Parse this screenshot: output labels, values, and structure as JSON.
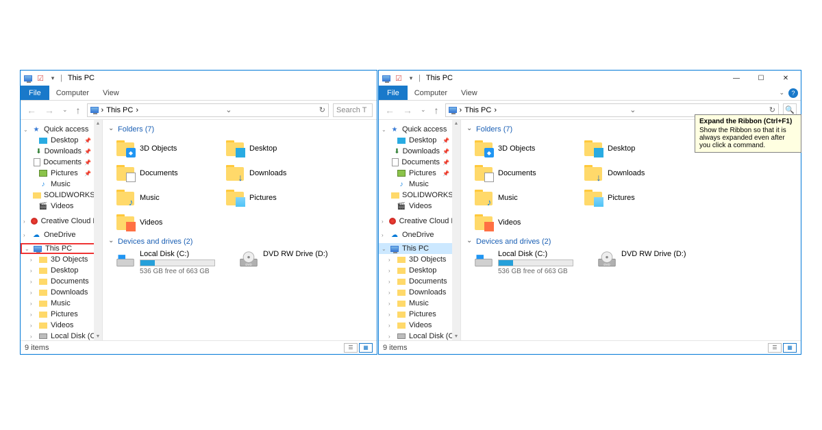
{
  "window_title": "This PC",
  "tabs": {
    "file": "File",
    "computer": "Computer",
    "view": "View"
  },
  "breadcrumb": "This PC",
  "addr_sep": "›",
  "search_placeholder": "Search T",
  "winctrl": {
    "min": "—",
    "max": "☐",
    "close": "✕"
  },
  "sidebar": {
    "quick_access": "Quick access",
    "desktop": "Desktop",
    "downloads": "Downloads",
    "documents": "Documents",
    "pictures": "Pictures",
    "music": "Music",
    "solidworks": "SOLIDWORKS Co",
    "videos": "Videos",
    "creative_cloud": "Creative Cloud Fil",
    "onedrive": "OneDrive",
    "this_pc": "This PC",
    "tc_3d": "3D Objects",
    "tc_desktop": "Desktop",
    "tc_documents": "Documents",
    "tc_downloads": "Downloads",
    "tc_music": "Music",
    "tc_pictures": "Pictures",
    "tc_videos": "Videos",
    "tc_localdisk": "Local Disk (C:)"
  },
  "sections": {
    "folders": "Folders (7)",
    "drives": "Devices and drives (2)"
  },
  "folders": {
    "f3d": "3D Objects",
    "desktop": "Desktop",
    "documents": "Documents",
    "downloads": "Downloads",
    "music": "Music",
    "pictures": "Pictures",
    "videos": "Videos"
  },
  "drives": {
    "local_name": "Local Disk (C:)",
    "local_free": "536 GB free of 663 GB",
    "local_fill_pct": 19,
    "dvd_name": "DVD RW Drive (D:)"
  },
  "status": {
    "items": "9 items"
  },
  "tooltip": {
    "title": "Expand the Ribbon (Ctrl+F1)",
    "body": "Show the Ribbon so that it is always expanded even after you click a command."
  }
}
